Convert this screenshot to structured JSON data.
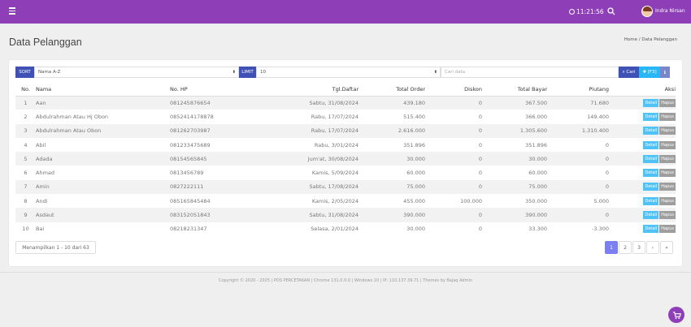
{
  "header": {
    "time": "11:21:56",
    "username": "Indra Nirsan"
  },
  "page": {
    "title": "Data Pelanggan",
    "breadcrumb_home": "Home",
    "breadcrumb_current": "Data Pelanggan"
  },
  "filters": {
    "sort_label": "SORT",
    "sort_value": "Nama A-Z",
    "limit_label": "LIMIT",
    "limit_value": "10",
    "search_placeholder": "Cari data",
    "search_button": "Cari",
    "f3_button": "[F3]"
  },
  "table": {
    "columns": [
      "No.",
      "Nama",
      "No. HP",
      "Tgl.Daftar",
      "Total Order",
      "Diskon",
      "Total Bayar",
      "Piutang",
      "Aksi"
    ],
    "detail_label": "Detail",
    "hapus_label": "Hapus",
    "rows": [
      {
        "no": "1",
        "nama": "Aan",
        "hp": "081245876654",
        "tgl": "Sabtu, 31/08/2024",
        "order": "439.180",
        "diskon": "0",
        "bayar": "367.500",
        "piutang": "71.680"
      },
      {
        "no": "2",
        "nama": "Abdulrahman Atau Hj Obon",
        "hp": "0852414178878",
        "tgl": "Rabu, 17/07/2024",
        "order": "515.400",
        "diskon": "0",
        "bayar": "366.000",
        "piutang": "149.400"
      },
      {
        "no": "3",
        "nama": "Abdulrahman Atau Obon",
        "hp": "081262703987",
        "tgl": "Rabu, 17/07/2024",
        "order": "2.616.000",
        "diskon": "0",
        "bayar": "1.305.600",
        "piutang": "1.310.400"
      },
      {
        "no": "4",
        "nama": "Abil",
        "hp": "081233475689",
        "tgl": "Rabu, 3/01/2024",
        "order": "351.896",
        "diskon": "0",
        "bayar": "351.896",
        "piutang": "0"
      },
      {
        "no": "5",
        "nama": "Adada",
        "hp": "08154565845",
        "tgl": "Jum'at, 30/08/2024",
        "order": "30.000",
        "diskon": "0",
        "bayar": "30.000",
        "piutang": "0"
      },
      {
        "no": "6",
        "nama": "Ahmad",
        "hp": "0813456789",
        "tgl": "Kamis, 5/09/2024",
        "order": "60.000",
        "diskon": "0",
        "bayar": "60.000",
        "piutang": "0"
      },
      {
        "no": "7",
        "nama": "Amin",
        "hp": "0827222111",
        "tgl": "Sabtu, 17/08/2024",
        "order": "75.000",
        "diskon": "0",
        "bayar": "75.000",
        "piutang": "0"
      },
      {
        "no": "8",
        "nama": "Andi",
        "hp": "085165845484",
        "tgl": "Kamis, 2/05/2024",
        "order": "455.000",
        "diskon": "100.000",
        "bayar": "350.000",
        "piutang": "5.000"
      },
      {
        "no": "9",
        "nama": "Asdaut",
        "hp": "083152051843",
        "tgl": "Sabtu, 31/08/2024",
        "order": "390.000",
        "diskon": "0",
        "bayar": "390.000",
        "piutang": "0"
      },
      {
        "no": "10",
        "nama": "Bai",
        "hp": "08218231347",
        "tgl": "Selasa, 2/01/2024",
        "order": "30.000",
        "diskon": "0",
        "bayar": "33.300",
        "piutang": "-3.300"
      }
    ]
  },
  "pagination": {
    "showing": "Menampilkan 1 - 10 dari 63",
    "pages": [
      "1",
      "2",
      "3",
      "›",
      "»"
    ],
    "active_page": "1"
  },
  "footer": {
    "text": "Copyright © 2020 - 2025 | POS PERCETAKAN | Chrome 131.0.0.0 | Windows 10 | IP: 110.137.39.71 | Themes by Bajaq Admin"
  }
}
